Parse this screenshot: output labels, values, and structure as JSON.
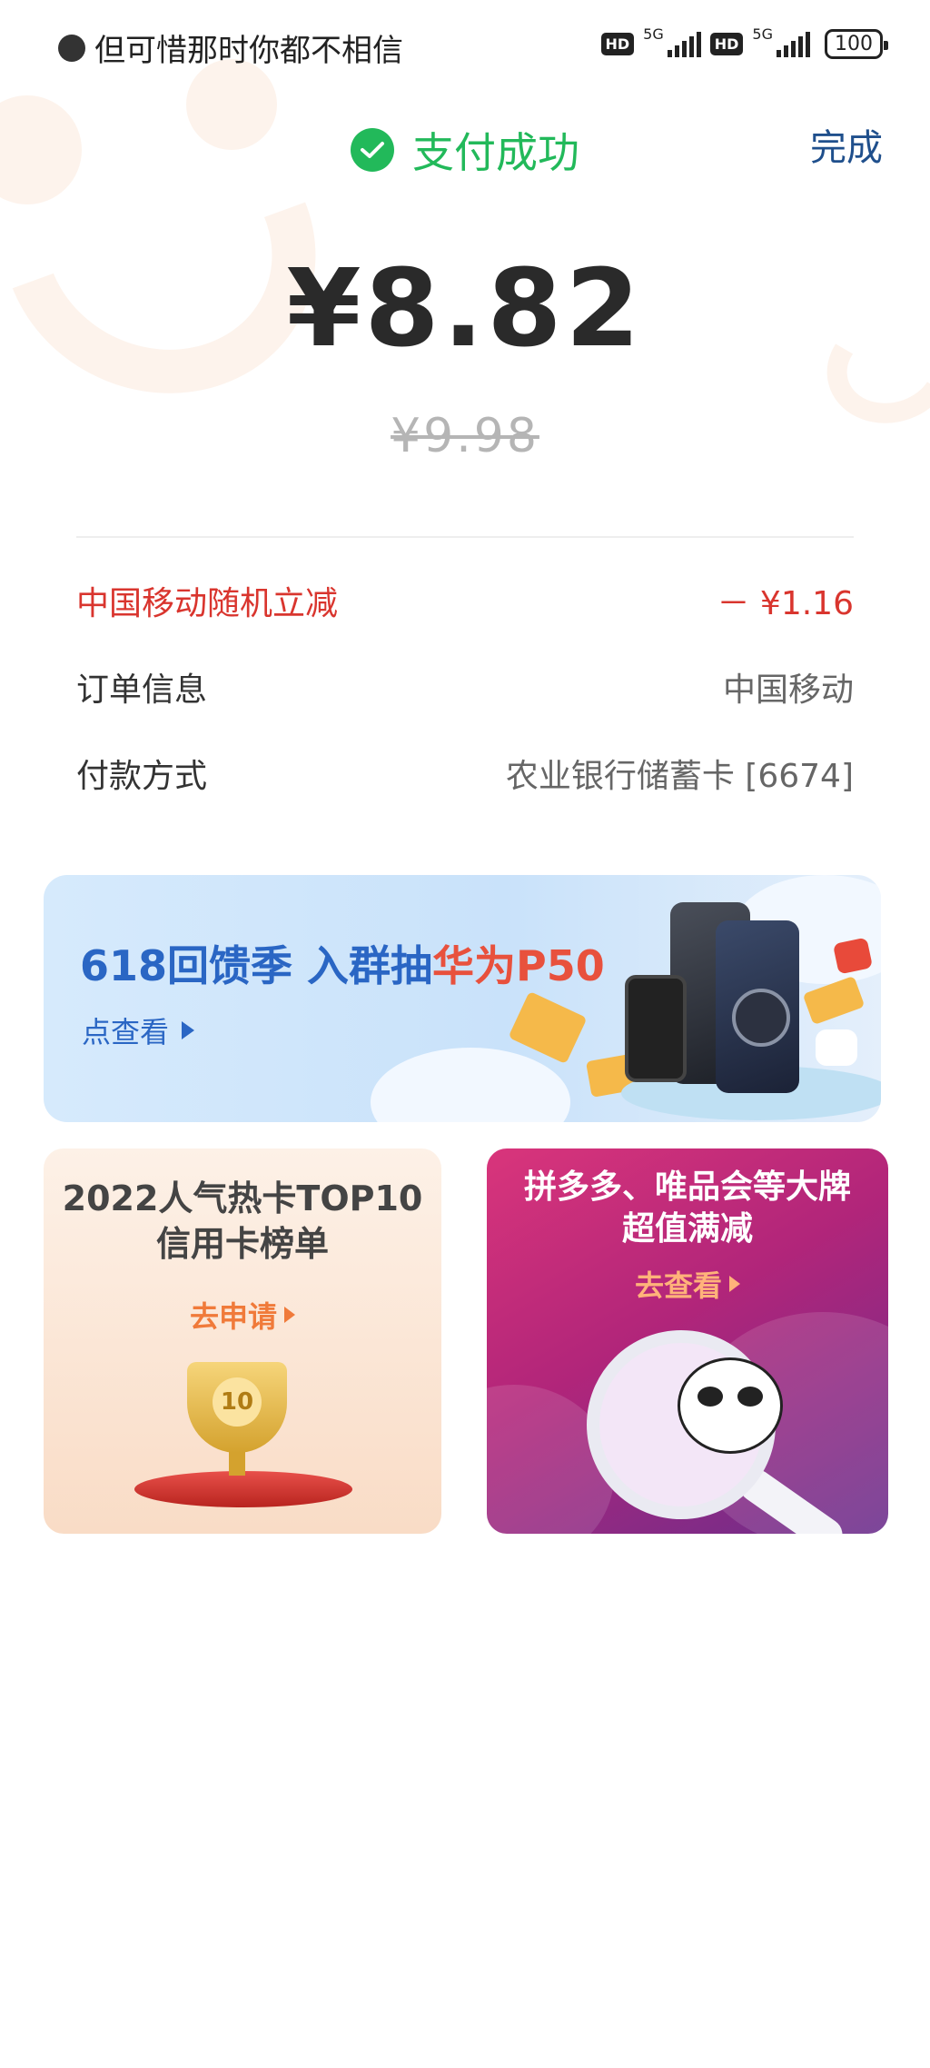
{
  "status_bar": {
    "carrier_text": "但可惜那时你都不相信",
    "hd1": "HD",
    "net1": "5G",
    "hd2": "HD",
    "net2": "5G",
    "battery": "100"
  },
  "header": {
    "status": "支付成功",
    "done_label": "完成",
    "status_color": "#22b95a"
  },
  "payment": {
    "amount": "¥8.82",
    "original_amount": "¥9.98"
  },
  "details": [
    {
      "label": "中国移动随机立减",
      "value": "－ ¥1.16",
      "highlight": true
    },
    {
      "label": "订单信息",
      "value": "中国移动",
      "highlight": false
    },
    {
      "label": "付款方式",
      "value": "农业银行储蓄卡 [6674]",
      "highlight": false
    }
  ],
  "banner": {
    "title_part1": "618回馈季 入群抽",
    "title_highlight": "华为P50",
    "link": "点查看"
  },
  "cards": {
    "left": {
      "title_line1": "2022人气热卡TOP10",
      "title_line2": "信用卡榜单",
      "cta": "去申请",
      "trophy_number": "10"
    },
    "right": {
      "title_line1": "拼多多、唯品会等大牌",
      "title_line2": "超值满减",
      "cta": "去查看"
    }
  }
}
